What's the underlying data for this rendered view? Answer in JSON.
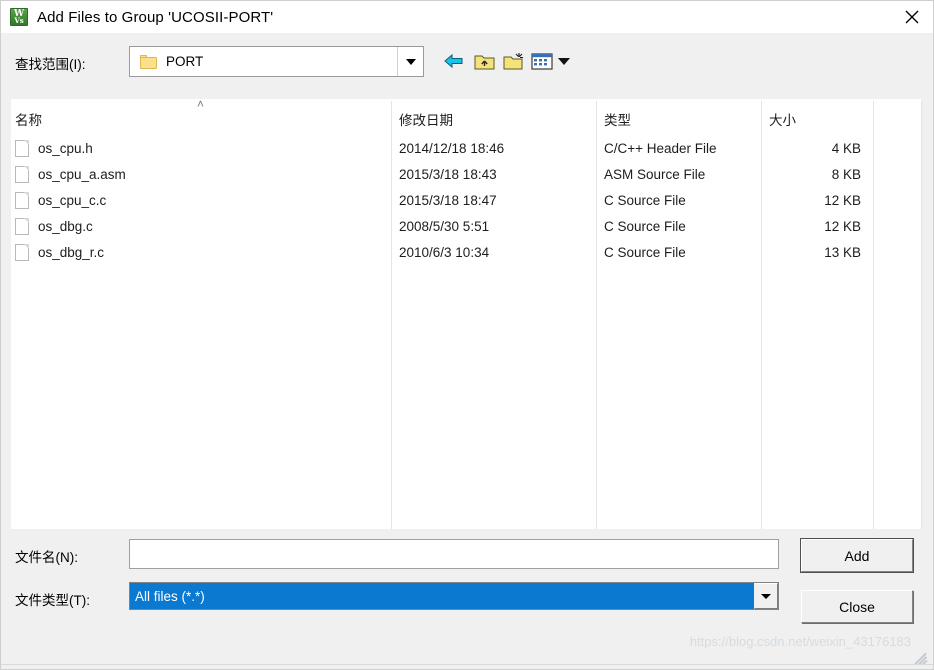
{
  "window": {
    "title": "Add Files to Group 'UCOSII-PORT'",
    "icon": "keil-uvision-icon",
    "close_label": "✕"
  },
  "lookin": {
    "label": "查找范围(I):",
    "value": "PORT",
    "folder_icon": "folder-icon",
    "dropdown_icon": "chevron-down-icon"
  },
  "toolbar": {
    "buttons": [
      {
        "name": "back-button",
        "icon": "back-arrow-icon",
        "tooltip": "Back"
      },
      {
        "name": "up-one-level-button",
        "icon": "up-folder-icon",
        "tooltip": "Up One Level"
      },
      {
        "name": "new-folder-button",
        "icon": "new-folder-icon",
        "tooltip": "Create New Folder"
      },
      {
        "name": "views-button",
        "icon": "views-icon",
        "tooltip": "Views"
      }
    ]
  },
  "file_list": {
    "sort_indicator": "˄",
    "sort_column": "名称",
    "columns": [
      "名称",
      "修改日期",
      "类型",
      "大小"
    ],
    "rows": [
      {
        "name": "os_cpu.h",
        "date": "2014/12/18 18:46",
        "type": "C/C++ Header File",
        "size": "4 KB",
        "icon": "document-icon"
      },
      {
        "name": "os_cpu_a.asm",
        "date": "2015/3/18 18:43",
        "type": "ASM Source File",
        "size": "8 KB",
        "icon": "document-icon"
      },
      {
        "name": "os_cpu_c.c",
        "date": "2015/3/18 18:47",
        "type": "C Source File",
        "size": "12 KB",
        "icon": "document-icon"
      },
      {
        "name": "os_dbg.c",
        "date": "2008/5/30 5:51",
        "type": "C Source File",
        "size": "12 KB",
        "icon": "document-icon"
      },
      {
        "name": "os_dbg_r.c",
        "date": "2010/6/3 10:34",
        "type": "C Source File",
        "size": "13 KB",
        "icon": "document-icon"
      }
    ]
  },
  "filename_field": {
    "label": "文件名(N):",
    "value": "",
    "placeholder": ""
  },
  "filetype_field": {
    "label": "文件类型(T):",
    "selected": "All files (*.*)",
    "dropdown_icon": "chevron-down-icon"
  },
  "actions": {
    "add_label": "Add",
    "close_label": "Close"
  },
  "watermark": {
    "text": "https://blog.csdn.net/weixin_43176183"
  },
  "colors": {
    "selection_blue": "#0b79d0",
    "dialog_face": "#f0f0f0",
    "folder_yellow": "#fbdf8b",
    "back_arrow_cyan": "#19c4e8"
  }
}
